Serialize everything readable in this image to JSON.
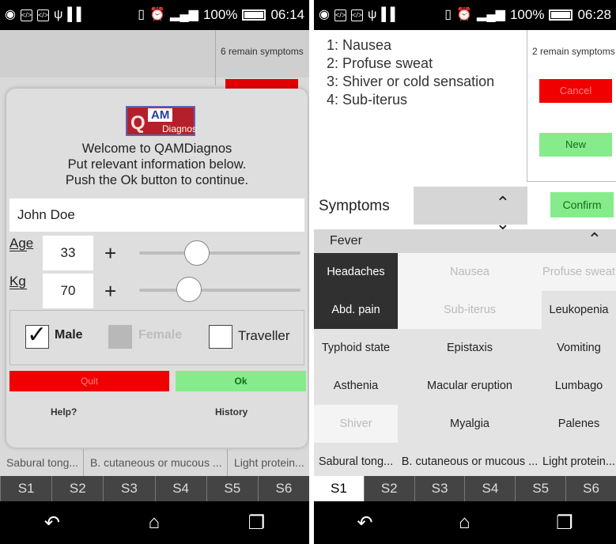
{
  "left": {
    "status": {
      "battery": "100%",
      "time": "06:14"
    },
    "remain_label": "6 remain symptoms",
    "dialog": {
      "logo": {
        "q": "Q",
        "am": "AM",
        "diagnos": "Diagnos"
      },
      "welcome_lines": [
        "Welcome to QAMDiagnos",
        "Put relevant information below.",
        "Push the Ok button to continue."
      ],
      "name_value": "John Doe",
      "age": {
        "label": "Age",
        "value": "33",
        "plus": "+",
        "slider_fraction": 0.36
      },
      "kg": {
        "label": "Kg",
        "value": "70",
        "plus": "+",
        "slider_fraction": 0.31
      },
      "checks": {
        "male": {
          "label": "Male",
          "checked": true
        },
        "female": {
          "label": "Female",
          "checked": false,
          "disabled": true
        },
        "traveller": {
          "label": "Traveller",
          "checked": false
        }
      },
      "quit_label": "Quit",
      "ok_label": "Ok",
      "help_label": "Help?",
      "history_label": "History"
    },
    "strip": [
      "Sabural tong...",
      "B. cutaneous or mucous ...",
      "Light protein..."
    ],
    "tabs": [
      "S1",
      "S2",
      "S3",
      "S4",
      "S5",
      "S6"
    ],
    "active_tab": "S1"
  },
  "right": {
    "status": {
      "battery": "100%",
      "time": "06:28"
    },
    "selected_symptoms": [
      "1: Nausea",
      "2: Profuse sweat",
      "3: Shiver or cold sensation",
      "4: Sub-iterus"
    ],
    "remain_label": "2 remain symptoms",
    "cancel_label": "Cancel",
    "new_label": "New",
    "symptoms_label": "Symptoms",
    "confirm_label": "Confirm",
    "category": "Fever",
    "grid": [
      [
        "Headaches",
        "Nausea",
        "Profuse sweat"
      ],
      [
        "Abd. pain",
        "Sub-iterus",
        "Leukopenia"
      ],
      [
        "Typhoid state",
        "Epistaxis",
        "Vomiting"
      ],
      [
        "Asthenia",
        "Macular eruption",
        "Lumbago"
      ],
      [
        "Shiver",
        "Myalgia",
        "Palenes"
      ],
      [
        "Sabural tong...",
        "B. cutaneous or mucous ...",
        "Light protein..."
      ]
    ],
    "tabs": [
      "S1",
      "S2",
      "S3",
      "S4",
      "S5",
      "S6"
    ],
    "active_tab": "S1"
  },
  "colors": {
    "red": "#f10000",
    "green": "#86ec8b",
    "dark_cell": "#303030"
  }
}
